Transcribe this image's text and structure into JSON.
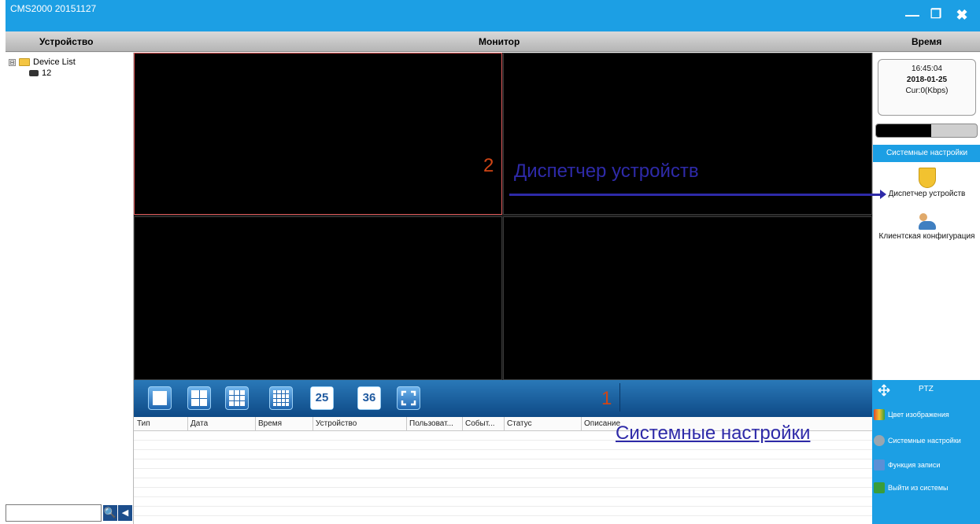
{
  "window": {
    "title": "CMS2000 20151127"
  },
  "header": {
    "device_label": "Устройство",
    "monitor_label": "Монитор",
    "time_label": "Время"
  },
  "device_tree": {
    "root_label": "Device List",
    "expander": "⊟",
    "child_label": "12"
  },
  "search": {
    "value": "",
    "search_glyph": "🔍",
    "collapse_glyph": "◀"
  },
  "clock": {
    "time": "16:45:04",
    "date": "2018-01-25",
    "rate": "Cur:0(Kbps)"
  },
  "bandwidth_progress_fraction": 0.55,
  "settings": {
    "header": "Системные настройки",
    "items": [
      {
        "label": "Диспетчер устройств",
        "icon": "shield-icon"
      },
      {
        "label": "Клиентская конфигурация",
        "icon": "people-icon"
      }
    ]
  },
  "toolbar": {
    "buttons": [
      {
        "name": "layout-1-button",
        "text": ""
      },
      {
        "name": "layout-4-button",
        "text": ""
      },
      {
        "name": "layout-9-button",
        "text": ""
      },
      {
        "name": "layout-16-button",
        "text": ""
      },
      {
        "name": "layout-25-button",
        "text": "25"
      },
      {
        "name": "layout-36-button",
        "text": "36"
      },
      {
        "name": "fullscreen-button",
        "text": ""
      }
    ]
  },
  "log_table": {
    "columns": [
      "Тип",
      "Дата",
      "Время",
      "Устройство",
      "Пользоват...",
      "Событ...",
      "Статус",
      "Описание"
    ]
  },
  "ptz": {
    "title": "PTZ",
    "items": [
      {
        "label": "Цвет изображения",
        "icon": "color-palette-icon",
        "color": "#e24a2a"
      },
      {
        "label": "Системные настройки",
        "icon": "gear-icon",
        "color": "#9aa6b0"
      },
      {
        "label": "Функция записи",
        "icon": "film-icon",
        "color": "#5c8fd6"
      },
      {
        "label": "Выйти из системы",
        "icon": "exit-door-icon",
        "color": "#3a9d3a"
      }
    ]
  },
  "annotations": {
    "label_device_manager": "Диспетчер устройств",
    "label_system_settings": "Системные настройки",
    "num_1": "1",
    "num_2": "2"
  },
  "colors": {
    "accent": "#1c9fe4",
    "annotation": "#2e2aa8",
    "number": "#d04515"
  }
}
